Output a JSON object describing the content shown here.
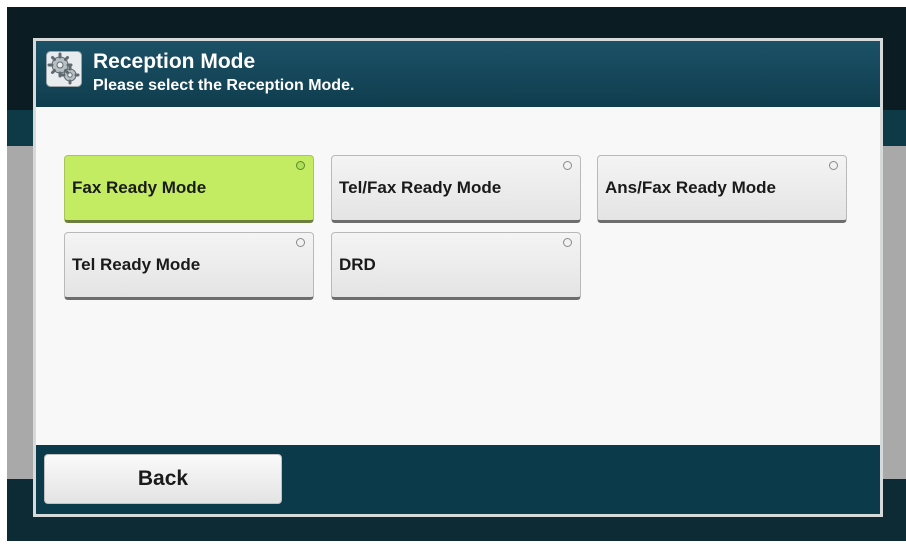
{
  "header": {
    "title": "Reception Mode",
    "subtitle": "Please select the Reception Mode.",
    "icon": "gears-icon"
  },
  "options": [
    {
      "label": "Fax Ready Mode",
      "selected": true
    },
    {
      "label": "Tel/Fax Ready Mode",
      "selected": false
    },
    {
      "label": "Ans/Fax Ready Mode",
      "selected": false
    },
    {
      "label": "Tel Ready Mode",
      "selected": false
    },
    {
      "label": "DRD",
      "selected": false
    }
  ],
  "footer": {
    "back_label": "Back"
  },
  "colors": {
    "header": "#1c5166",
    "selected": "#c3ec63",
    "footer": "#0b3b4b"
  }
}
